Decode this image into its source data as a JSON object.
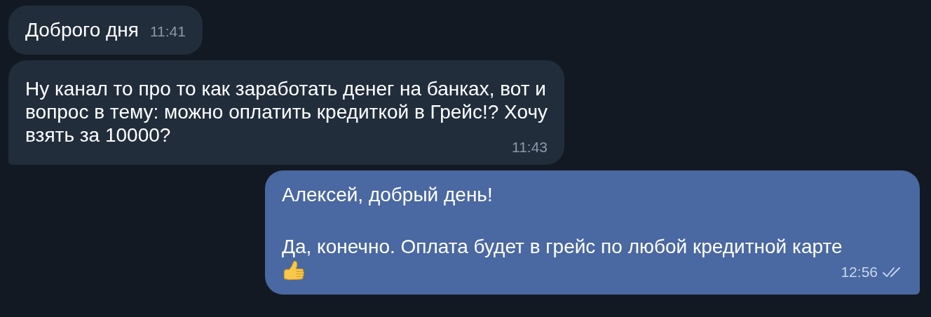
{
  "messages": [
    {
      "outgoing": false,
      "kind": "inline",
      "text": "Доброго дня",
      "time": "11:41",
      "tail": false
    },
    {
      "outgoing": false,
      "kind": "block",
      "text": "Ну канал то про то как заработать денег на банках, вот и\nвопрос в тему: можно оплатить кредиткой в Грейс!? Хочу\nвзять за 10000?",
      "time": "11:43",
      "tail": true
    },
    {
      "outgoing": true,
      "kind": "block",
      "text": "Алексей, добрый день!\n\nДа, конечно. Оплата будет в грейс по любой кредитной карте",
      "thumbs_up": true,
      "time": "12:56",
      "read": true,
      "tail": true
    }
  ]
}
